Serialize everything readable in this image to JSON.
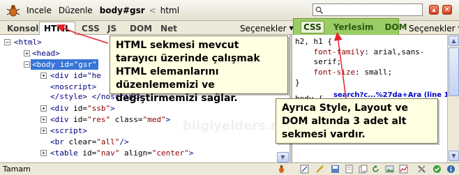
{
  "topbar": {
    "menus": [
      "Incele",
      "Düzenle"
    ],
    "breadcrumb_bold": "body#gsr",
    "breadcrumb_sep": "<",
    "breadcrumb_next": "html",
    "search_placeholder": ""
  },
  "tabs": [
    "Konsol",
    "HTML",
    "CSS",
    "JS",
    "DOM",
    "Net"
  ],
  "options_label": "Seçenekler",
  "side_tabs": [
    "CSS",
    "Yerlesim",
    "DOM"
  ],
  "side_options_label": "Seçenekler",
  "html_tree": {
    "l1": "<html>",
    "l2": "<head>",
    "l3_tag": "<body",
    "l3_attr": " id=",
    "l3_val": "\"gsr\"",
    "l4": "<div id=\"he",
    "l5": "<noscript>",
    "l6": "</style> </noscript>",
    "l7_tag": "<div",
    "l7_attr": " id=",
    "l7_val": "\"ssb\"",
    "l7_end": ">",
    "l8_tag": "<div",
    "l8_attr": " id=",
    "l8_val": "\"res\"",
    "l8_attr2": " class=",
    "l8_val2": "\"med\"",
    "l8_end": ">",
    "l9": "<script>",
    "l10_tag": "<br",
    "l10_attr": " clear=",
    "l10_val": "\"all\"",
    "l10_end": "/>",
    "l11_tag": "<table",
    "l11_attr": " id=",
    "l11_val": "\"nav\"",
    "l11_attr2": " align=",
    "l11_val2": "\"center\"",
    "l11_end": ">"
  },
  "css_panel": {
    "r1": "h2, h1 {",
    "r2_prop": "    font-family",
    "r2_val": ": arial,sans-",
    "r3": "    serif;",
    "r4_prop": "    font-size",
    "r4_val": ": small;",
    "r5": "}",
    "r6": "body {",
    "link": "search?c...%27da+Ara (line 1)"
  },
  "callouts": {
    "c1": "HTML sekmesi mevcut tarayıcı üzerinde çalışmak HTML elemanlarını düzenlememizi ve değiştirmemizi sağlar.",
    "c2": "Ayrıca Style, Layout ve DOM altında 3 adet alt sekmesi vardır."
  },
  "watermark": "bilgiyelders.net",
  "status": "Tamam",
  "colors": {
    "accent_green": "#9bcc66",
    "callout_bg": "#ffffe1",
    "arrow_red": "#e8202a",
    "selection_blue": "#3875d7"
  }
}
